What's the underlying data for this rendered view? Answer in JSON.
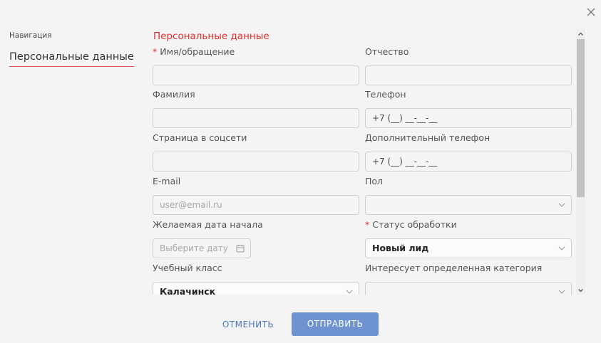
{
  "nav": {
    "caption": "Навигация",
    "items": [
      {
        "label": "Персональные данные"
      }
    ]
  },
  "form": {
    "section_title": "Персональные данные",
    "fields": {
      "name": {
        "label": "Имя/обращение",
        "required_mark": "*",
        "value": ""
      },
      "patronymic": {
        "label": "Отчество",
        "value": ""
      },
      "surname": {
        "label": "Фамилия",
        "value": ""
      },
      "phone": {
        "label": "Телефон",
        "value": "+7 (__) __-__-__"
      },
      "social": {
        "label": "Страница в соцсети",
        "value": ""
      },
      "extra_phone": {
        "label": "Дополнительный телефон",
        "value": "+7 (__) __-__-__"
      },
      "email": {
        "label": "E-mail",
        "placeholder": "user@email.ru",
        "value": ""
      },
      "gender": {
        "label": "Пол",
        "value": ""
      },
      "start_date": {
        "label": "Желаемая дата начала",
        "placeholder": "Выберите дату"
      },
      "status": {
        "label": "Статус обработки",
        "required_mark": "*",
        "value": "Новый лид"
      },
      "classroom": {
        "label": "Учебный класс",
        "value": "Калачинск"
      },
      "category": {
        "label": "Интересует определенная категория",
        "value": ""
      }
    }
  },
  "footer": {
    "cancel_label": "ОТМЕНИТЬ",
    "submit_label": "ОТПРАВИТЬ"
  },
  "icons": {
    "close": "close-icon",
    "dropdown": "chevron-down-icon",
    "calendar": "calendar-icon",
    "scroll_up": "arrow-up-icon",
    "scroll_down": "arrow-down-icon"
  },
  "colors": {
    "accent_red": "#e03131",
    "button_blue": "#6f93d0",
    "link_blue": "#4a76c1"
  }
}
